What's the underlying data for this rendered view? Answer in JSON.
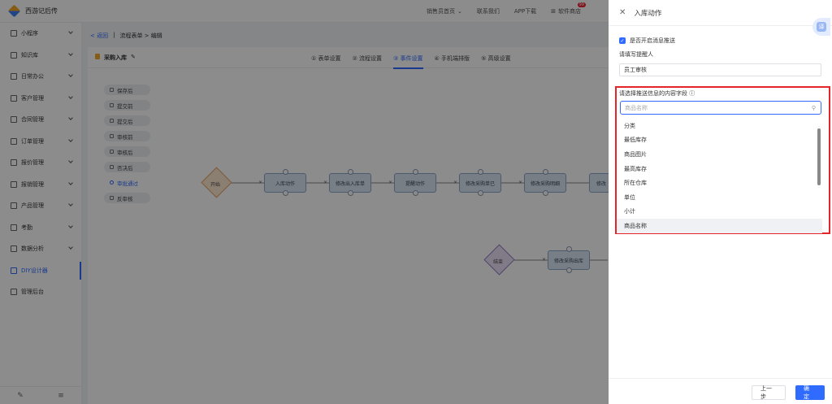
{
  "app": {
    "title": "西游记后传"
  },
  "topnav": [
    {
      "label": "销售员首页",
      "has_chevron": true
    },
    {
      "label": "联系我们"
    },
    {
      "label": "APP下载"
    },
    {
      "label": "软件商店",
      "badge": "99"
    }
  ],
  "sidebar": {
    "items": [
      {
        "label": "小程序",
        "icon": "grid-icon"
      },
      {
        "label": "知识库",
        "icon": "book-icon"
      },
      {
        "label": "日常办公",
        "icon": "briefcase-icon"
      },
      {
        "label": "客户管理",
        "icon": "user-icon"
      },
      {
        "label": "合同管理",
        "icon": "contract-icon"
      },
      {
        "label": "订单管理",
        "icon": "order-icon"
      },
      {
        "label": "报价管理",
        "icon": "quote-icon"
      },
      {
        "label": "报销管理",
        "icon": "reimburse-icon"
      },
      {
        "label": "产品管理",
        "icon": "product-icon"
      },
      {
        "label": "考勤",
        "icon": "attendance-icon"
      },
      {
        "label": "数据分析",
        "icon": "chart-icon"
      },
      {
        "label": "DIY设计器",
        "icon": "designer-icon",
        "active": true
      },
      {
        "label": "管理后台",
        "icon": "admin-icon"
      }
    ],
    "bottom_icons": [
      "edit-icon",
      "collapse-icon"
    ]
  },
  "breadcrumb": {
    "back": "< 返回",
    "path": "流程表单 > 编辑"
  },
  "form": {
    "title": "采购入库",
    "steps": [
      "① 表单设置",
      "② 流程设置",
      "③ 事件设置",
      "④ 手机端排版",
      "⑤ 高级设置"
    ],
    "active_step": 2
  },
  "events": [
    "保存后",
    "提交前",
    "提交后",
    "审核前",
    "审核后",
    "否决后",
    "审批通过",
    "反审核"
  ],
  "active_event": 6,
  "flow_nodes": {
    "start": "开始",
    "row1": [
      "入库动作",
      "修改出入库单",
      "提醒动作",
      "修改采购单已",
      "修改采购明细",
      "修改"
    ],
    "end": "结束",
    "row2": [
      "修改采购出库"
    ]
  },
  "drawer": {
    "title": "入库动作",
    "translate_label": "译",
    "push_checkbox_label": "是否开启消息推送",
    "push_checked": true,
    "reminder_label": "请填写提醒人",
    "reminder_value": "员工审核",
    "content_label": "请选择推送信息的内容字段",
    "search_placeholder": "商品名称",
    "options": [
      "分类",
      "最低库存",
      "商品图片",
      "最高库存",
      "所在仓库",
      "单位",
      "小计",
      "商品名称"
    ],
    "hovered_option": 7,
    "prev_button": "上一步",
    "ok_button": "确 定"
  },
  "colors": {
    "accent": "#2f6bff",
    "highlight_border": "#e4262a"
  }
}
